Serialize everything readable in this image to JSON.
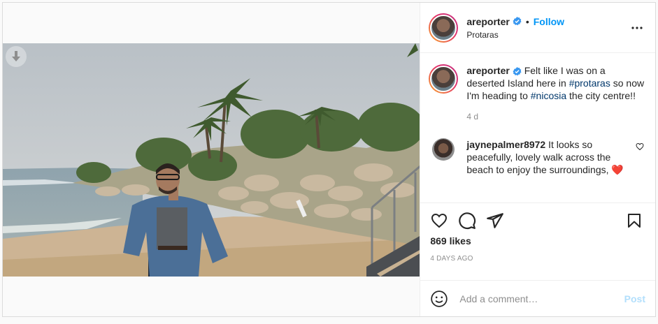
{
  "post": {
    "author": {
      "username": "areporter",
      "verified": true,
      "location": "Protaras",
      "follow_label": "Follow",
      "separator": "•"
    },
    "more_icon": "more-horizontal-icon",
    "caption": {
      "username": "areporter",
      "text_1": " Felt like I was on a deserted Island here in ",
      "tag_1": "#protaras",
      "text_2": " so now I'm heading to ",
      "tag_2": "#nicosia",
      "text_3": " the city centre!!",
      "age": "4 d"
    },
    "comments": [
      {
        "username": "jaynepalmer8972",
        "text": " It looks so peacefully, lovely walk across the beach to enjoy the surroundings, ❤️❤️❤️"
      }
    ],
    "likes": "869 likes",
    "date": "4 DAYS AGO",
    "add_comment": {
      "placeholder": "Add a comment…",
      "post_label": "Post"
    }
  },
  "colors": {
    "accent": "#0095f6",
    "hashtag": "#00376b",
    "muted": "#8e8e8e",
    "post_disabled": "#b2dffc"
  }
}
